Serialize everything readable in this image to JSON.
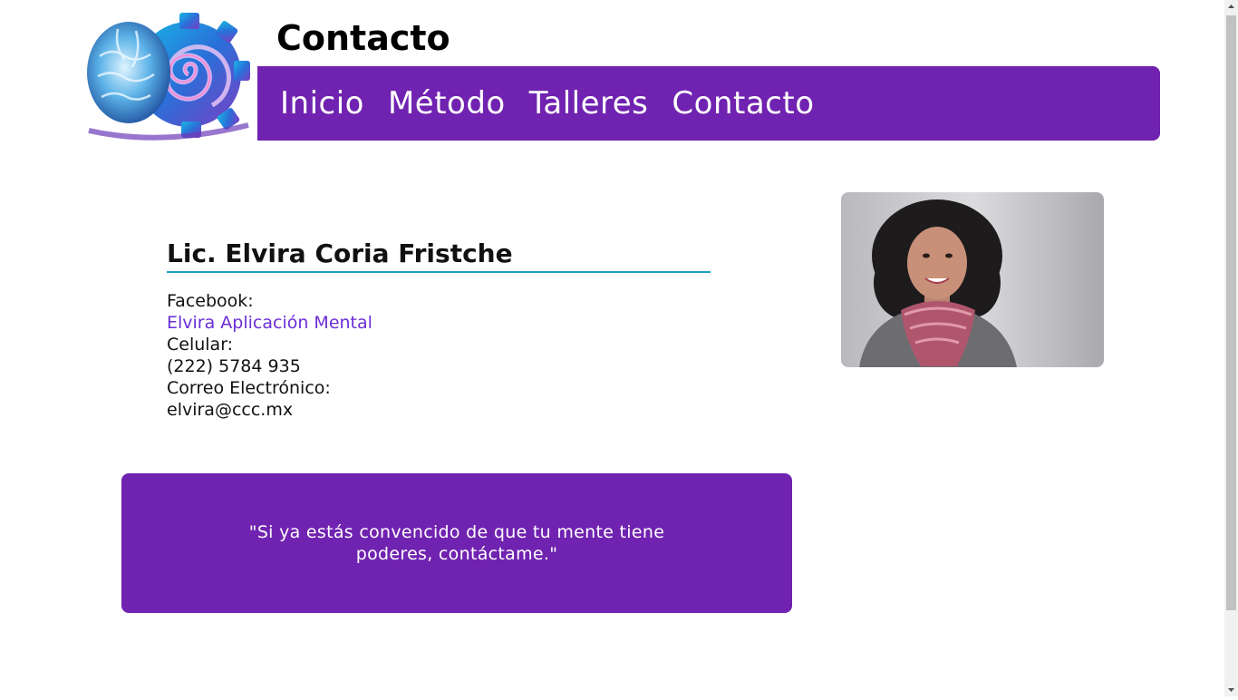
{
  "header": {
    "page_title": "Contacto",
    "logo_icon": "brain-spiral-gear-logo"
  },
  "nav": {
    "items": [
      {
        "label": "Inicio"
      },
      {
        "label": "Método"
      },
      {
        "label": "Talleres"
      },
      {
        "label": "Contacto"
      }
    ],
    "background_color": "#7022b0"
  },
  "contact": {
    "name": "Lic. Elvira Coria Fristche",
    "facebook_label": "Facebook:",
    "facebook_link": "Elvira Aplicación Mental",
    "phone_label": "Celular:",
    "phone_value": "(222) 5784 935",
    "email_label": "Correo Electrónico:",
    "email_value": "elvira@ccc.mx",
    "accent_color": "#1e9ec2",
    "link_color": "#6b2ed6"
  },
  "photo": {
    "icon": "portrait-photo"
  },
  "quote": {
    "text": "\"Si ya estás convencido de que tu mente tiene poderes, contáctame.\""
  }
}
